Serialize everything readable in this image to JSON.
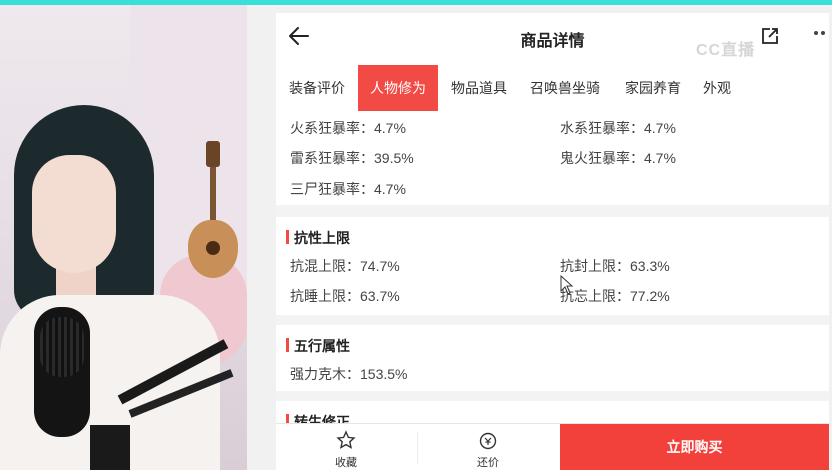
{
  "header": {
    "title": "商品详情",
    "watermark": "CC直播"
  },
  "tabs": [
    {
      "label": "装备评价"
    },
    {
      "label": "人物修为",
      "active": true
    },
    {
      "label": "物品道具"
    },
    {
      "label": "召唤兽坐骑"
    },
    {
      "label": "家园养育"
    },
    {
      "label": "外观"
    }
  ],
  "crazy_crit": {
    "fire": "火系狂暴率：4.7%",
    "water": "水系狂暴率：4.7%",
    "thunder": "雷系狂暴率：39.5%",
    "ghostfire": "鬼火狂暴率：4.7%",
    "sanshi": "三尸狂暴率：4.7%"
  },
  "resist_cap": {
    "title": "抗性上限",
    "hunluan": "抗混上限：74.7%",
    "fengyin": "抗封上限：63.3%",
    "shuimian": "抗睡上限：63.7%",
    "yiwang": "抗忘上限：77.2%"
  },
  "five_elements": {
    "title": "五行属性",
    "strong_wood": "强力克木：153.5%"
  },
  "rebirth": {
    "title": "转生修正"
  },
  "bottom_bar": {
    "favorite": "收藏",
    "bargain": "还价",
    "buy_now": "立即购买"
  },
  "colors": {
    "accent": "#f24a45",
    "frame": "#39e0d8"
  }
}
